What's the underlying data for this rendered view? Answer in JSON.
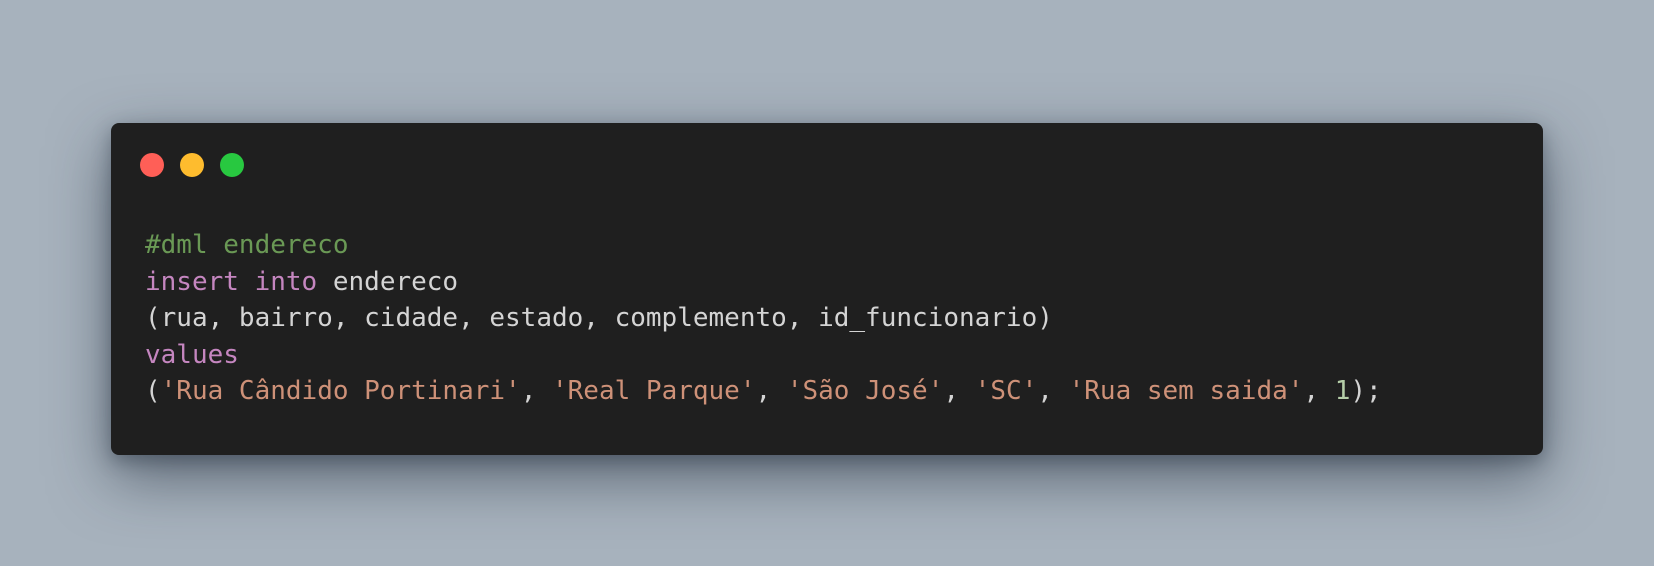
{
  "window": {
    "controls": {
      "close_color": "#ff5f57",
      "minimize_color": "#febc2e",
      "maximize_color": "#28c840"
    }
  },
  "code": {
    "language": "sql",
    "lines": [
      [
        {
          "type": "comment",
          "text": "#dml endereco"
        }
      ],
      [
        {
          "type": "keyword",
          "text": "insert"
        },
        {
          "type": "plain",
          "text": " "
        },
        {
          "type": "keyword",
          "text": "into"
        },
        {
          "type": "plain",
          "text": " endereco"
        }
      ],
      [
        {
          "type": "plain",
          "text": "(rua, bairro, cidade, estado, complemento, id_funcionario)"
        }
      ],
      [
        {
          "type": "keyword",
          "text": "values"
        }
      ],
      [
        {
          "type": "plain",
          "text": "("
        },
        {
          "type": "string",
          "text": "'Rua Cândido Portinari'"
        },
        {
          "type": "plain",
          "text": ", "
        },
        {
          "type": "string",
          "text": "'Real Parque'"
        },
        {
          "type": "plain",
          "text": ", "
        },
        {
          "type": "string",
          "text": "'São José'"
        },
        {
          "type": "plain",
          "text": ", "
        },
        {
          "type": "string",
          "text": "'SC'"
        },
        {
          "type": "plain",
          "text": ", "
        },
        {
          "type": "string",
          "text": "'Rua sem saida'"
        },
        {
          "type": "plain",
          "text": ", "
        },
        {
          "type": "number",
          "text": "1"
        },
        {
          "type": "plain",
          "text": ");"
        }
      ]
    ],
    "colors": {
      "comment": "#6a9955",
      "keyword": "#c586c0",
      "plain": "#d4d4d4",
      "string": "#ce9178",
      "number": "#b5cea8",
      "background": "#1f1f1f",
      "page_background": "#a7b2bd"
    }
  }
}
